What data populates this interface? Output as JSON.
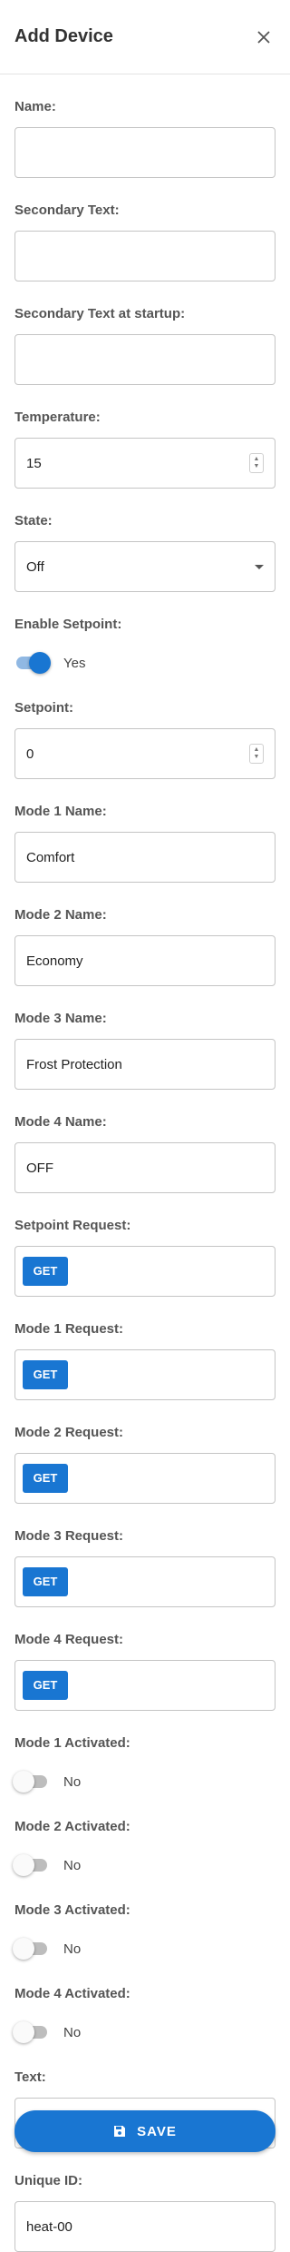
{
  "dialog": {
    "title": "Add Device"
  },
  "fields": {
    "name": {
      "label": "Name:",
      "value": ""
    },
    "secondary_text": {
      "label": "Secondary Text:",
      "value": ""
    },
    "secondary_text_startup": {
      "label": "Secondary Text at startup:",
      "value": ""
    },
    "temperature": {
      "label": "Temperature:",
      "value": "15"
    },
    "state": {
      "label": "State:",
      "value": "Off"
    },
    "enable_setpoint": {
      "label": "Enable Setpoint:",
      "value": "Yes",
      "checked": true
    },
    "setpoint": {
      "label": "Setpoint:",
      "value": "0"
    },
    "mode1_name": {
      "label": "Mode 1 Name:",
      "value": "Comfort"
    },
    "mode2_name": {
      "label": "Mode 2 Name:",
      "value": "Economy"
    },
    "mode3_name": {
      "label": "Mode 3 Name:",
      "value": "Frost Protection"
    },
    "mode4_name": {
      "label": "Mode 4 Name:",
      "value": "OFF"
    },
    "setpoint_request": {
      "label": "Setpoint Request:",
      "method": "GET"
    },
    "mode1_request": {
      "label": "Mode 1 Request:",
      "method": "GET"
    },
    "mode2_request": {
      "label": "Mode 2 Request:",
      "method": "GET"
    },
    "mode3_request": {
      "label": "Mode 3 Request:",
      "method": "GET"
    },
    "mode4_request": {
      "label": "Mode 4 Request:",
      "method": "GET"
    },
    "mode1_activated": {
      "label": "Mode 1 Activated:",
      "value": "No",
      "checked": false
    },
    "mode2_activated": {
      "label": "Mode 2 Activated:",
      "value": "No",
      "checked": false
    },
    "mode3_activated": {
      "label": "Mode 3 Activated:",
      "value": "No",
      "checked": false
    },
    "mode4_activated": {
      "label": "Mode 4 Activated:",
      "value": "No",
      "checked": false
    },
    "text": {
      "label": "Text:",
      "value": ""
    },
    "unique_id": {
      "label": "Unique ID:",
      "value": "heat-00"
    }
  },
  "actions": {
    "save_label": "SAVE"
  },
  "colors": {
    "accent": "#1976d2",
    "switch_track_on": "#90b8e3",
    "switch_off": "#bdbdbd"
  },
  "icons": {
    "close": "close-icon",
    "save": "floppy-disk-icon",
    "stepper": "stepper-arrows-icon",
    "dropdown": "caret-down-icon"
  }
}
